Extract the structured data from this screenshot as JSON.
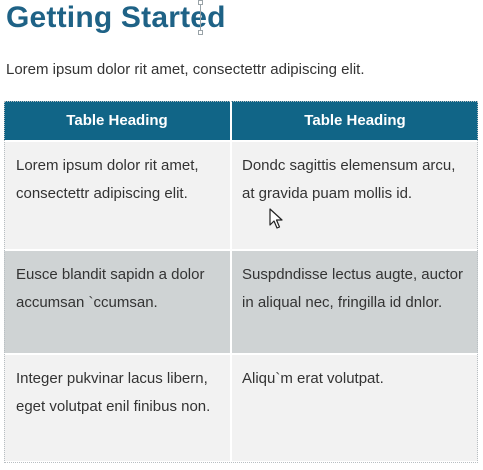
{
  "document": {
    "title": "Getting Started",
    "intro": "Lorem ipsum dolor rit amet, consectettr adipiscing elit."
  },
  "table": {
    "headers": [
      "Table Heading",
      "Table Heading"
    ],
    "rows": [
      [
        "Lorem ipsum dolor rit amet, consectettr adipiscing elit.",
        "Dondc sagittis elemensum arcu, at gravida puam mollis id."
      ],
      [
        "Eusce blandit sapidn a dolor accumsan `ccumsan.",
        "Suspdndisse lectus augte, auctor in aliqual nec, fringilla id dnlor."
      ],
      [
        "Integer pukvinar lacus libern, eget volutpat enil finibus non.",
        "Aliqu`m erat volutpat."
      ]
    ]
  },
  "colors": {
    "title": "#1e6286",
    "header_background": "#116587",
    "row_light": "#f2f2f2",
    "row_dark": "#cfd3d4",
    "body_text": "#333333"
  },
  "icons": {
    "cursor": "arrow-pointer-icon",
    "text_cursor": "text-insertion-cursor-icon"
  }
}
